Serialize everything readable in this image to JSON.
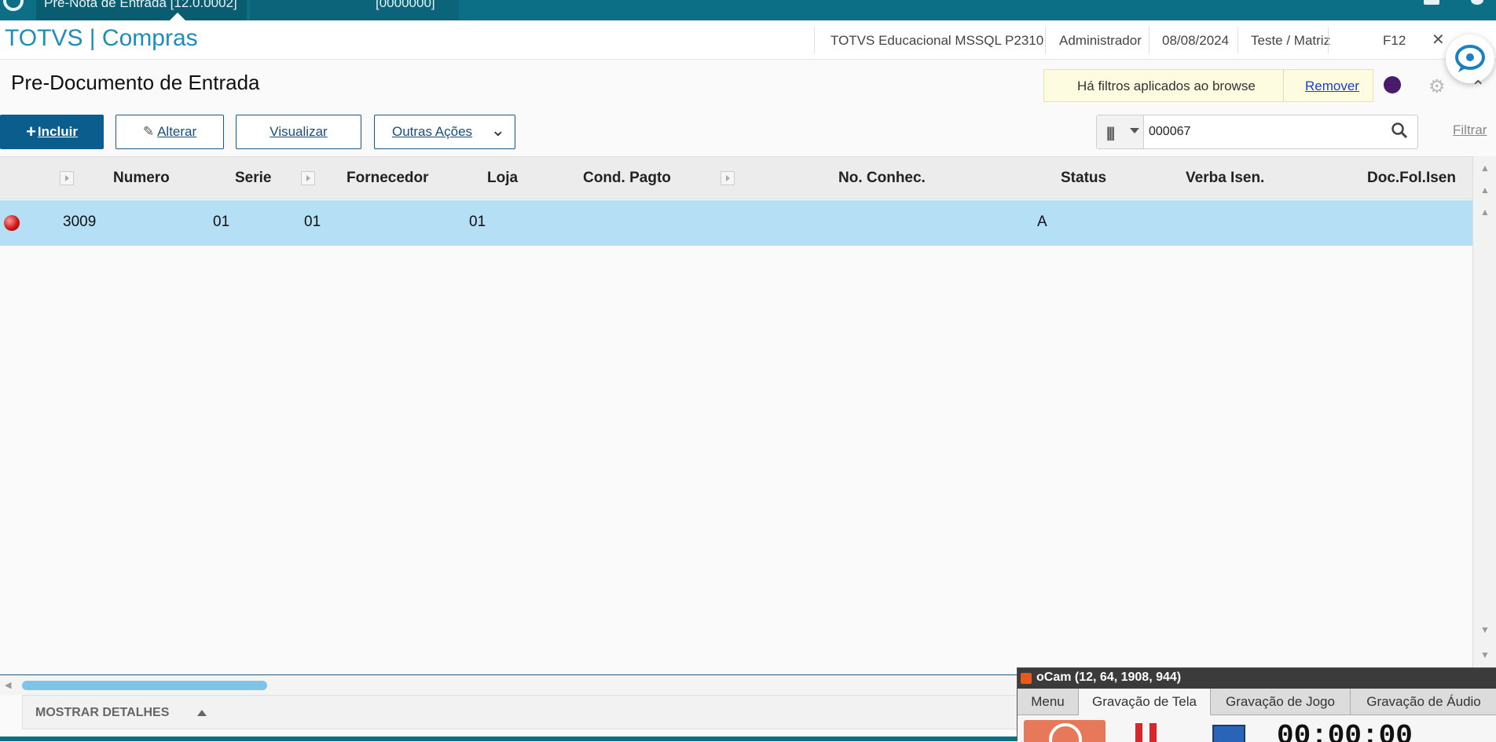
{
  "topbar": {
    "tab1_label": "Pre-Nota de Entrada [12.0.0002]",
    "tab2_label": "[0000000]"
  },
  "header": {
    "app_title": "TOTVS | Compras",
    "environment": "TOTVS Educacional MSSQL P2310",
    "user": "Administrador",
    "date": "08/08/2024",
    "company": "Teste / Matriz",
    "shortcut": "F12",
    "close_glyph": "✕"
  },
  "page": {
    "title": "Pre-Documento de Entrada",
    "filter_notice": "Há filtros aplicados ao browse",
    "filter_remove": "Remover"
  },
  "actions": {
    "incluir": "Incluir",
    "alterar": "Alterar",
    "visualizar": "Visualizar",
    "outras": "Outras Ações"
  },
  "search": {
    "value": "000067",
    "filter_link": "Filtrar"
  },
  "grid": {
    "columns": [
      "Numero",
      "Serie",
      "Fornecedor",
      "Loja",
      "Cond. Pagto",
      "No. Conhec.",
      "Status",
      "Verba Isen.",
      "Doc.Fol.Isen"
    ],
    "rows": [
      {
        "legend_color": "#d01818",
        "numero": "3009",
        "serie": "01",
        "fornecedor": "01",
        "loja": "01",
        "cond_pagto": "",
        "no_conhec": "",
        "status": "A",
        "verba_isen": "",
        "doc_fol_isen": ""
      }
    ]
  },
  "footer": {
    "details_label": "MOSTRAR DETALHES"
  },
  "ocam": {
    "title": "oCam (12, 64, 1908, 944)",
    "tabs": [
      "Menu",
      "Gravação de Tela",
      "Gravação de Jogo",
      "Gravação de Áudio"
    ],
    "active_tab": "Gravação de Tela",
    "timer": "00:00:00"
  },
  "colors": {
    "brand_teal": "#0c6f86",
    "title_blue": "#1b8fb8",
    "primary_button": "#0a5d8c",
    "row_selected": "#b4dff5",
    "filter_banner": "#fdfbe0"
  },
  "icons": [
    "search-icon",
    "pencil-icon",
    "plus-icon",
    "chevron-down-icon",
    "gear-icon",
    "chat-icon",
    "column-selector-icon",
    "status-led-icon"
  ]
}
